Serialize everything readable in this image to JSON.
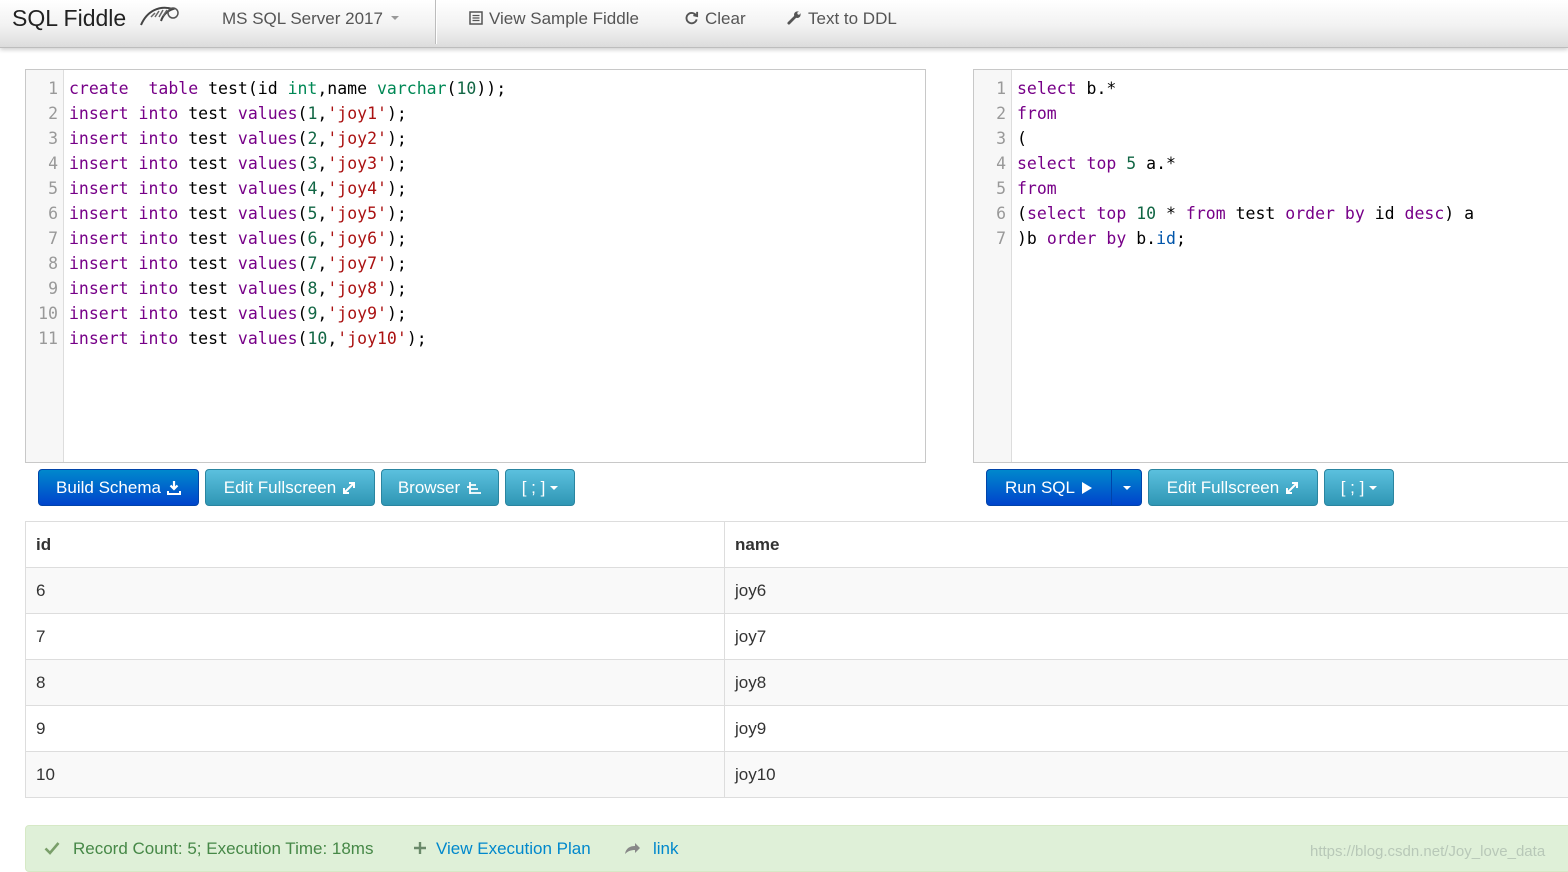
{
  "navbar": {
    "brand": "SQL Fiddle",
    "db_selector": "MS SQL Server 2017",
    "view_sample": "View Sample Fiddle",
    "clear": "Clear",
    "text_to_ddl": "Text to DDL"
  },
  "schema_editor": {
    "lines": [
      {
        "n": "1",
        "tokens": [
          [
            "kw",
            "create"
          ],
          [
            "",
            "  "
          ],
          [
            "kw",
            "table"
          ],
          [
            "",
            " test(id "
          ],
          [
            "ty",
            "int"
          ],
          [
            "",
            ",name "
          ],
          [
            "ty",
            "varchar"
          ],
          [
            "",
            "("
          ],
          [
            "nm",
            "10"
          ],
          [
            "",
            "));"
          ]
        ]
      },
      {
        "n": "2",
        "tokens": [
          [
            "kw",
            "insert"
          ],
          [
            "",
            " "
          ],
          [
            "kw",
            "into"
          ],
          [
            "",
            " test "
          ],
          [
            "kw",
            "values"
          ],
          [
            "",
            "("
          ],
          [
            "nm",
            "1"
          ],
          [
            "",
            ","
          ],
          [
            "st",
            "'joy1'"
          ],
          [
            "",
            ");"
          ]
        ]
      },
      {
        "n": "3",
        "tokens": [
          [
            "kw",
            "insert"
          ],
          [
            "",
            " "
          ],
          [
            "kw",
            "into"
          ],
          [
            "",
            " test "
          ],
          [
            "kw",
            "values"
          ],
          [
            "",
            "("
          ],
          [
            "nm",
            "2"
          ],
          [
            "",
            ","
          ],
          [
            "st",
            "'joy2'"
          ],
          [
            "",
            ");"
          ]
        ]
      },
      {
        "n": "4",
        "tokens": [
          [
            "kw",
            "insert"
          ],
          [
            "",
            " "
          ],
          [
            "kw",
            "into"
          ],
          [
            "",
            " test "
          ],
          [
            "kw",
            "values"
          ],
          [
            "",
            "("
          ],
          [
            "nm",
            "3"
          ],
          [
            "",
            ","
          ],
          [
            "st",
            "'joy3'"
          ],
          [
            "",
            ");"
          ]
        ]
      },
      {
        "n": "5",
        "tokens": [
          [
            "kw",
            "insert"
          ],
          [
            "",
            " "
          ],
          [
            "kw",
            "into"
          ],
          [
            "",
            " test "
          ],
          [
            "kw",
            "values"
          ],
          [
            "",
            "("
          ],
          [
            "nm",
            "4"
          ],
          [
            "",
            ","
          ],
          [
            "st",
            "'joy4'"
          ],
          [
            "",
            ");"
          ]
        ]
      },
      {
        "n": "6",
        "tokens": [
          [
            "kw",
            "insert"
          ],
          [
            "",
            " "
          ],
          [
            "kw",
            "into"
          ],
          [
            "",
            " test "
          ],
          [
            "kw",
            "values"
          ],
          [
            "",
            "("
          ],
          [
            "nm",
            "5"
          ],
          [
            "",
            ","
          ],
          [
            "st",
            "'joy5'"
          ],
          [
            "",
            ");"
          ]
        ]
      },
      {
        "n": "7",
        "tokens": [
          [
            "kw",
            "insert"
          ],
          [
            "",
            " "
          ],
          [
            "kw",
            "into"
          ],
          [
            "",
            " test "
          ],
          [
            "kw",
            "values"
          ],
          [
            "",
            "("
          ],
          [
            "nm",
            "6"
          ],
          [
            "",
            ","
          ],
          [
            "st",
            "'joy6'"
          ],
          [
            "",
            ");"
          ]
        ]
      },
      {
        "n": "8",
        "tokens": [
          [
            "kw",
            "insert"
          ],
          [
            "",
            " "
          ],
          [
            "kw",
            "into"
          ],
          [
            "",
            " test "
          ],
          [
            "kw",
            "values"
          ],
          [
            "",
            "("
          ],
          [
            "nm",
            "7"
          ],
          [
            "",
            ","
          ],
          [
            "st",
            "'joy7'"
          ],
          [
            "",
            ");"
          ]
        ]
      },
      {
        "n": "9",
        "tokens": [
          [
            "kw",
            "insert"
          ],
          [
            "",
            " "
          ],
          [
            "kw",
            "into"
          ],
          [
            "",
            " test "
          ],
          [
            "kw",
            "values"
          ],
          [
            "",
            "("
          ],
          [
            "nm",
            "8"
          ],
          [
            "",
            ","
          ],
          [
            "st",
            "'joy8'"
          ],
          [
            "",
            ");"
          ]
        ]
      },
      {
        "n": "10",
        "tokens": [
          [
            "kw",
            "insert"
          ],
          [
            "",
            " "
          ],
          [
            "kw",
            "into"
          ],
          [
            "",
            " test "
          ],
          [
            "kw",
            "values"
          ],
          [
            "",
            "("
          ],
          [
            "nm",
            "9"
          ],
          [
            "",
            ","
          ],
          [
            "st",
            "'joy9'"
          ],
          [
            "",
            ");"
          ]
        ]
      },
      {
        "n": "11",
        "tokens": [
          [
            "kw",
            "insert"
          ],
          [
            "",
            " "
          ],
          [
            "kw",
            "into"
          ],
          [
            "",
            " test "
          ],
          [
            "kw",
            "values"
          ],
          [
            "",
            "("
          ],
          [
            "nm",
            "10"
          ],
          [
            "",
            ","
          ],
          [
            "st",
            "'joy10'"
          ],
          [
            "",
            ");"
          ]
        ]
      }
    ]
  },
  "query_editor": {
    "lines": [
      {
        "n": "1",
        "tokens": [
          [
            "kw",
            "select"
          ],
          [
            "",
            " b.*"
          ]
        ]
      },
      {
        "n": "2",
        "tokens": [
          [
            "kw",
            "from"
          ]
        ]
      },
      {
        "n": "3",
        "tokens": [
          [
            "",
            "("
          ]
        ]
      },
      {
        "n": "4",
        "tokens": [
          [
            "kw",
            "select"
          ],
          [
            "",
            " "
          ],
          [
            "kw",
            "top"
          ],
          [
            "",
            " "
          ],
          [
            "nm",
            "5"
          ],
          [
            "",
            " a.*"
          ]
        ]
      },
      {
        "n": "5",
        "tokens": [
          [
            "kw",
            "from"
          ]
        ]
      },
      {
        "n": "6",
        "tokens": [
          [
            "",
            "("
          ],
          [
            "kw",
            "select"
          ],
          [
            "",
            " "
          ],
          [
            "kw",
            "top"
          ],
          [
            "",
            " "
          ],
          [
            "nm",
            "10"
          ],
          [
            "",
            " * "
          ],
          [
            "kw",
            "from"
          ],
          [
            "",
            " test "
          ],
          [
            "kw",
            "order"
          ],
          [
            "",
            " "
          ],
          [
            "kw",
            "by"
          ],
          [
            "",
            " id "
          ],
          [
            "kw",
            "desc"
          ],
          [
            "",
            ") a"
          ]
        ]
      },
      {
        "n": "7",
        "tokens": [
          [
            "",
            ")b "
          ],
          [
            "kw",
            "order"
          ],
          [
            "",
            " "
          ],
          [
            "kw",
            "by"
          ],
          [
            "",
            " b."
          ],
          [
            "vr",
            "id"
          ],
          [
            "",
            ";"
          ]
        ]
      }
    ]
  },
  "schema_buttons": {
    "build": "Build Schema",
    "fullscreen": "Edit Fullscreen",
    "browser": "Browser",
    "terminator": "[ ; ]"
  },
  "query_buttons": {
    "run": "Run SQL",
    "fullscreen": "Edit Fullscreen",
    "terminator": "[ ; ]"
  },
  "results": {
    "columns": [
      "id",
      "name"
    ],
    "rows": [
      [
        "6",
        "joy6"
      ],
      [
        "7",
        "joy7"
      ],
      [
        "8",
        "joy8"
      ],
      [
        "9",
        "joy9"
      ],
      [
        "10",
        "joy10"
      ]
    ]
  },
  "status": {
    "record_info": "Record Count: 5; Execution Time: 18ms",
    "execution_plan": "View Execution Plan",
    "link": "link"
  },
  "watermark": "https://blog.csdn.net/Joy_love_data",
  "colors": {
    "primary": "#0044cc",
    "info": "#2f96b4",
    "keyword": "#770088",
    "type": "#008855",
    "number": "#116644",
    "string": "#aa1111",
    "success_bg": "#dff0d8"
  },
  "icons": [
    "dolphin-logo-icon",
    "list-icon",
    "refresh-icon",
    "wrench-icon",
    "download-icon",
    "expand-icon",
    "sitemap-icon",
    "play-icon",
    "caret-down-icon",
    "check-icon",
    "plus-icon",
    "share-icon"
  ]
}
